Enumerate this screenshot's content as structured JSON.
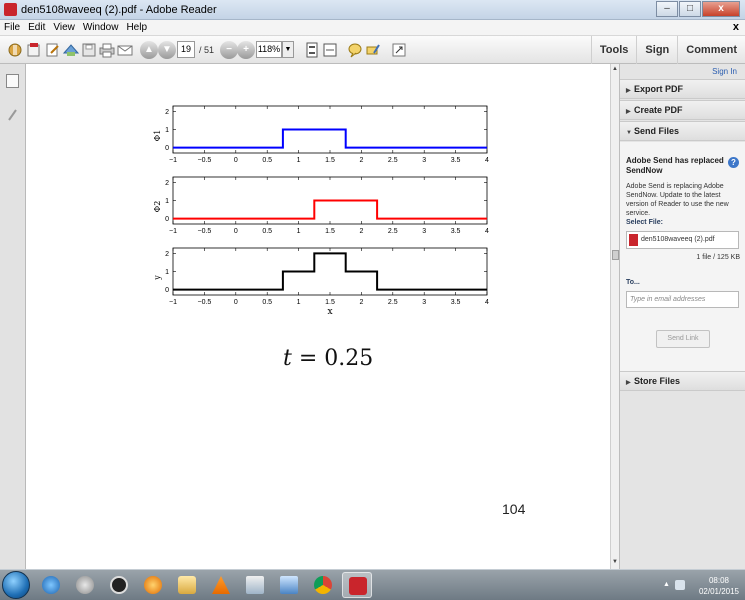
{
  "window": {
    "title": "den5108waveeq (2).pdf - Adobe Reader",
    "min": "–",
    "max": "□",
    "close": "x"
  },
  "menu": [
    "File",
    "Edit",
    "View",
    "Window",
    "Help"
  ],
  "menu_close": "x",
  "toolbar": {
    "page_current": "19",
    "page_total": "/ 51",
    "zoom": "118%",
    "right": [
      "Tools",
      "Sign",
      "Comment"
    ]
  },
  "panel": {
    "signin": "Sign In",
    "export": "Export PDF",
    "create": "Create PDF",
    "send": "Send Files",
    "send_title": "Adobe Send has replaced SendNow",
    "send_text": "Adobe Send is replacing Adobe SendNow. Update to the latest version of Reader to use the new service.",
    "select_label": "Select File:",
    "file_name": "den5108waveeq (2).pdf",
    "file_info": "1 file / 125 KB",
    "to_label": "To...",
    "email_placeholder": "Type in email addresses",
    "send_link": "Send Link",
    "store": "Store Files"
  },
  "doc": {
    "t_var": "t",
    "t_rest": " = 0.25",
    "page_number": "104"
  },
  "taskbar": {
    "time": "08:08",
    "date": "02/01/2015"
  },
  "chart_data": [
    {
      "type": "line",
      "ylabel": "Φ1",
      "color": "#0000ff",
      "xlim": [
        -1,
        4
      ],
      "ylim": [
        -0.3,
        2.3
      ],
      "xticks": [
        "-1",
        "-0.5",
        "0",
        "0.5",
        "1",
        "1.5",
        "2",
        "2.5",
        "3",
        "3.5",
        "4"
      ],
      "yticks": [
        "0",
        "1",
        "2"
      ],
      "x": [
        -1,
        0.75,
        0.75,
        1.75,
        1.75,
        4
      ],
      "y": [
        0,
        0,
        1,
        1,
        0,
        0
      ]
    },
    {
      "type": "line",
      "ylabel": "Φ2",
      "color": "#ff0000",
      "xlim": [
        -1,
        4
      ],
      "ylim": [
        -0.3,
        2.3
      ],
      "xticks": [
        "-1",
        "-0.5",
        "0",
        "0.5",
        "1",
        "1.5",
        "2",
        "2.5",
        "3",
        "3.5",
        "4"
      ],
      "yticks": [
        "0",
        "1",
        "2"
      ],
      "x": [
        -1,
        1.25,
        1.25,
        2.25,
        2.25,
        4
      ],
      "y": [
        0,
        0,
        1,
        1,
        0,
        0
      ]
    },
    {
      "type": "line",
      "ylabel": "y",
      "xlabel": "x",
      "color": "#000000",
      "xlim": [
        -1,
        4
      ],
      "ylim": [
        -0.3,
        2.3
      ],
      "xticks": [
        "-1",
        "-0.5",
        "0",
        "0.5",
        "1",
        "1.5",
        "2",
        "2.5",
        "3",
        "3.5",
        "4"
      ],
      "yticks": [
        "0",
        "1",
        "2"
      ],
      "x": [
        -1,
        0.75,
        0.75,
        1.25,
        1.25,
        1.75,
        1.75,
        2.25,
        2.25,
        4
      ],
      "y": [
        0,
        0,
        1,
        1,
        2,
        2,
        1,
        1,
        0,
        0
      ]
    }
  ]
}
